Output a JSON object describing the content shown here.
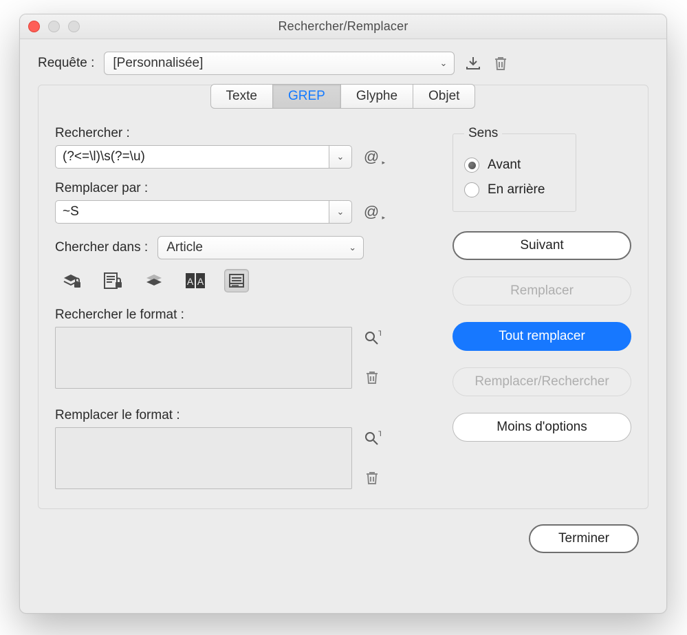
{
  "window": {
    "title": "Rechercher/Remplacer"
  },
  "query": {
    "label": "Requête :",
    "value": "[Personnalisée]"
  },
  "tabs": {
    "texte": "Texte",
    "grep": "GREP",
    "glyphe": "Glyphe",
    "objet": "Objet",
    "active": "grep"
  },
  "find": {
    "label": "Rechercher :",
    "value": "(?<=\\l)\\s(?=\\u)"
  },
  "replace": {
    "label": "Remplacer par :",
    "value": "~S"
  },
  "searchIn": {
    "label": "Chercher dans :",
    "value": "Article"
  },
  "findFormat": {
    "label": "Rechercher le format :"
  },
  "replaceFormat": {
    "label": "Remplacer le format :"
  },
  "direction": {
    "legend": "Sens",
    "forward": "Avant",
    "backward": "En arrière",
    "selected": "forward"
  },
  "buttons": {
    "next": "Suivant",
    "replace": "Remplacer",
    "replaceAll": "Tout remplacer",
    "replaceFind": "Remplacer/Rechercher",
    "lessOptions": "Moins d'options",
    "done": "Terminer"
  }
}
